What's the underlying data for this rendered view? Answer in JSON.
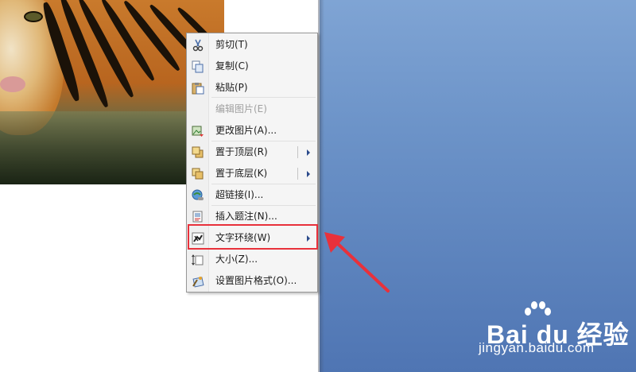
{
  "menu": {
    "items": [
      {
        "label": "剪切(T)",
        "icon": "scissors-icon",
        "enabled": true,
        "submenu": false
      },
      {
        "label": "复制(C)",
        "icon": "copy-icon",
        "enabled": true,
        "submenu": false
      },
      {
        "label": "粘贴(P)",
        "icon": "paste-icon",
        "enabled": true,
        "submenu": false
      },
      {
        "label": "编辑图片(E)",
        "icon": "",
        "enabled": false,
        "submenu": false
      },
      {
        "label": "更改图片(A)...",
        "icon": "change-picture-icon",
        "enabled": true,
        "submenu": false
      },
      {
        "label": "置于顶层(R)",
        "icon": "bring-to-front-icon",
        "enabled": true,
        "submenu": true
      },
      {
        "label": "置于底层(K)",
        "icon": "send-to-back-icon",
        "enabled": true,
        "submenu": true
      },
      {
        "label": "超链接(I)...",
        "icon": "hyperlink-icon",
        "enabled": true,
        "submenu": false
      },
      {
        "label": "插入题注(N)...",
        "icon": "caption-icon",
        "enabled": true,
        "submenu": false
      },
      {
        "label": "文字环绕(W)",
        "icon": "text-wrap-icon",
        "enabled": true,
        "submenu": true
      },
      {
        "label": "大小(Z)...",
        "icon": "size-icon",
        "enabled": true,
        "submenu": false
      },
      {
        "label": "设置图片格式(O)...",
        "icon": "format-picture-icon",
        "enabled": true,
        "submenu": false
      }
    ]
  },
  "highlight_color": "#e8313b",
  "watermark": {
    "logo": "Bai du 经验",
    "url": "jingyan.baidu.com"
  }
}
